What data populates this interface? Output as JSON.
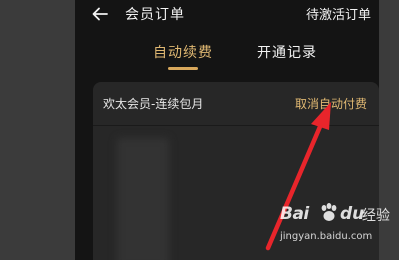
{
  "header": {
    "title": "会员订单",
    "pending_link": "待激活订单"
  },
  "tabs": [
    {
      "label": "自动续费",
      "active": true
    },
    {
      "label": "开通记录",
      "active": false
    }
  ],
  "card": {
    "plan_title": "欢太会员-连续包月",
    "cancel_label": "取消自动付费"
  },
  "watermark": {
    "brand_prefix": "Bai",
    "brand_suffix": "du",
    "brand_product": "经验",
    "url": "jingyan.baidu.com"
  },
  "colors": {
    "accent_gold": "#e0b872",
    "arrow_red": "#e8252b",
    "background": "#141414",
    "card": "#272727"
  }
}
